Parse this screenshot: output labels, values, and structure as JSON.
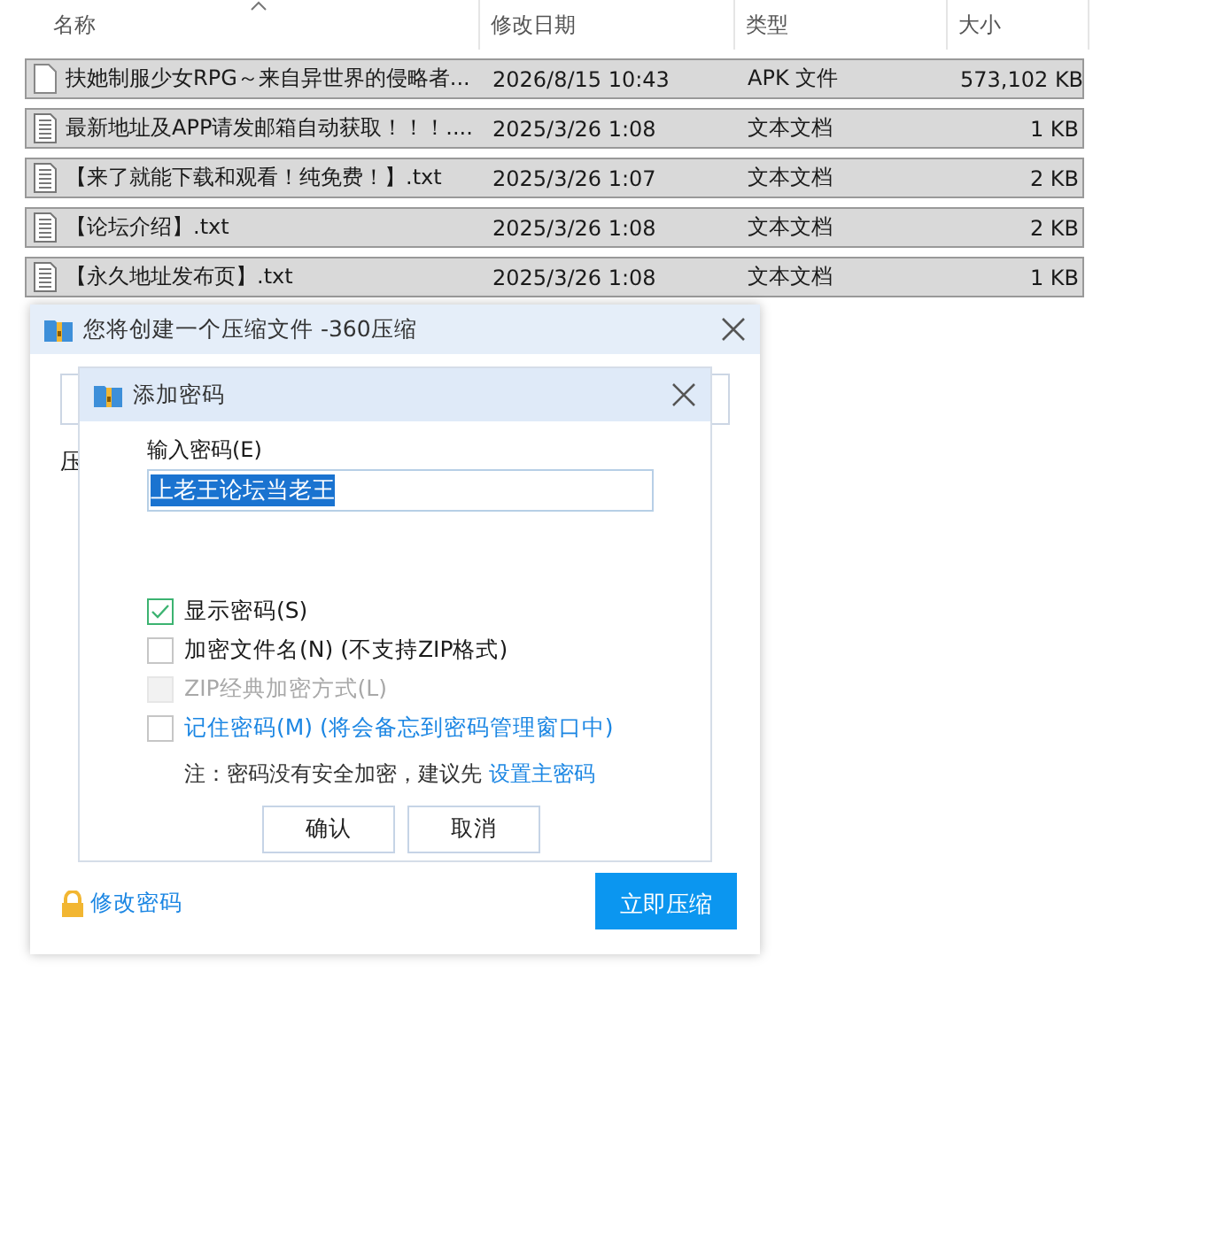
{
  "file_list": {
    "columns": [
      {
        "label": "名称",
        "sorted": true
      },
      {
        "label": "修改日期",
        "sorted": false
      },
      {
        "label": "类型",
        "sorted": false
      },
      {
        "label": "大小",
        "sorted": false
      }
    ],
    "rows": [
      {
        "kind": "apk",
        "name": "扶她制服少女RPG～来自异世界的侵略者...",
        "date": "2026/8/15 10:43",
        "type": "APK 文件",
        "size": "573,102 KB",
        "selected": true
      },
      {
        "kind": "txt",
        "name": "最新地址及APP请发邮箱自动获取！！！....",
        "date": "2025/3/26 1:08",
        "type": "文本文档",
        "size": "1 KB",
        "selected": true
      },
      {
        "kind": "txt",
        "name": "【来了就能下载和观看！纯免费！】.txt",
        "date": "2025/3/26 1:07",
        "type": "文本文档",
        "size": "2 KB",
        "selected": true
      },
      {
        "kind": "txt",
        "name": "【论坛介绍】.txt",
        "date": "2025/3/26 1:08",
        "type": "文本文档",
        "size": "2 KB",
        "selected": true
      },
      {
        "kind": "txt",
        "name": "【永久地址发布页】.txt",
        "date": "2025/3/26 1:08",
        "type": "文本文档",
        "size": "1 KB",
        "selected": true
      }
    ]
  },
  "compress_dialog": {
    "title": "您将创建一个压缩文件 -360压缩",
    "label": "压",
    "link": "修改密码",
    "button": "立即压缩"
  },
  "password_dialog": {
    "title": "添加密码",
    "password_label": "输入密码(E)",
    "password": "上老王论坛当老王",
    "options": [
      {
        "kind": "plain",
        "label": "显示密码(S)",
        "checked": true,
        "disabled": false
      },
      {
        "kind": "plain",
        "label": "加密文件名(N) (不支持ZIP格式)",
        "checked": false,
        "disabled": false
      },
      {
        "kind": "plain",
        "label": "ZIP经典加密方式(L)",
        "checked": false,
        "disabled": true
      },
      {
        "kind": "link",
        "label": "记住密码(M) (将会备忘到密码管理窗口中)",
        "checked": false,
        "disabled": false
      }
    ],
    "note": "注：密码没有安全加密，建议先",
    "note_link": "设置主密码",
    "buttons": [
      "确认",
      "取消"
    ]
  }
}
